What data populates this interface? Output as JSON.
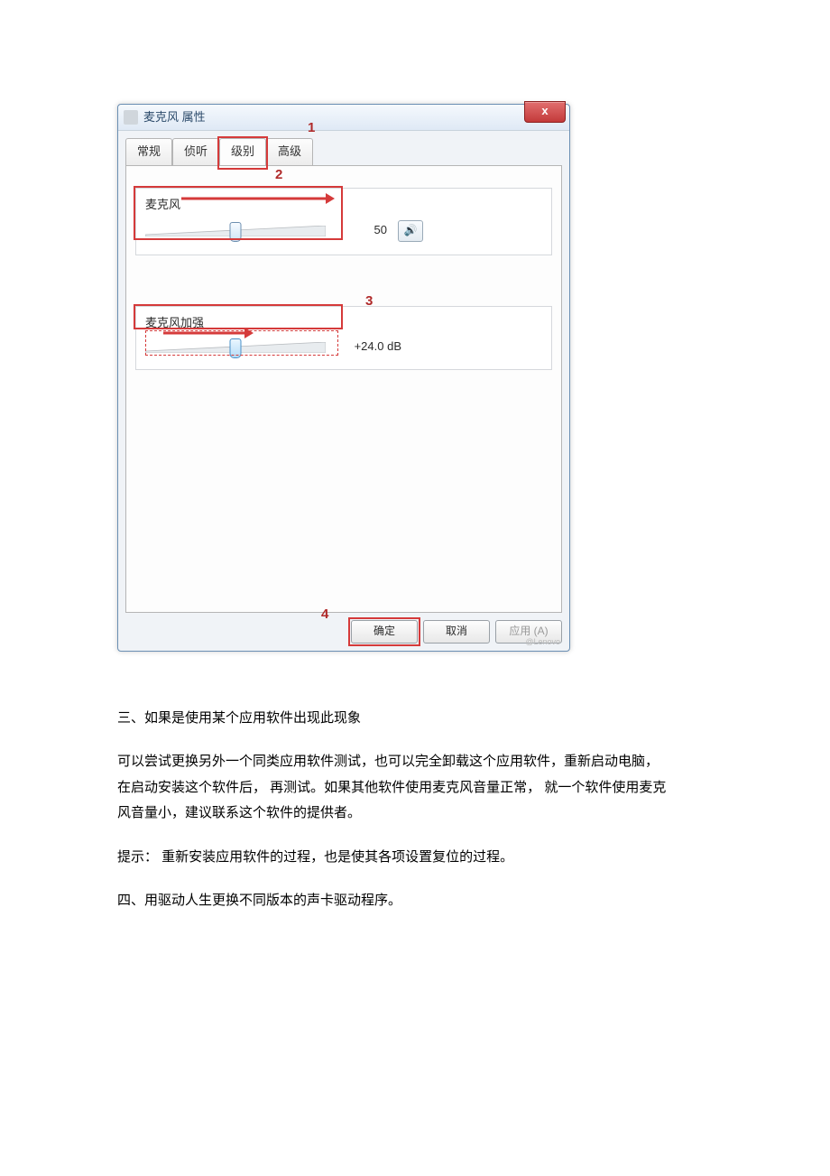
{
  "dialog": {
    "title": "麦克风 属性",
    "close_label": "x",
    "tabs": [
      "常规",
      "侦听",
      "级别",
      "高级"
    ],
    "active_tab_index": 2,
    "group1": {
      "label": "麦克风",
      "value": "50",
      "thumb_percent": 50
    },
    "group2": {
      "label": "麦克风加强",
      "value": "+24.0 dB",
      "thumb_percent": 50
    },
    "buttons": {
      "ok": "确定",
      "cancel": "取消",
      "apply": "应用 (A)"
    }
  },
  "annotations": {
    "n1": "1",
    "n2": "2",
    "n3": "3",
    "n4": "4"
  },
  "body": {
    "heading3": "三、如果是使用某个应用软件出现此现象",
    "p1a": "可以尝试更换另外一个同类应用软件测试，也可以完全卸载这个应用软件，重新启动电脑，",
    "p1b": "在启动安装这个软件后，    再测试。如果其他软件使用麦克风音量正常，    就一个软件使用麦克",
    "p1c": "风音量小，建议联系这个软件的提供者。",
    "tip": "提示：  重新安装应用软件的过程，也是使其各项设置复位的过程。",
    "heading4": "四、用驱动人生更换不同版本的声卡驱动程序。"
  },
  "watermark": "@Lenovo"
}
